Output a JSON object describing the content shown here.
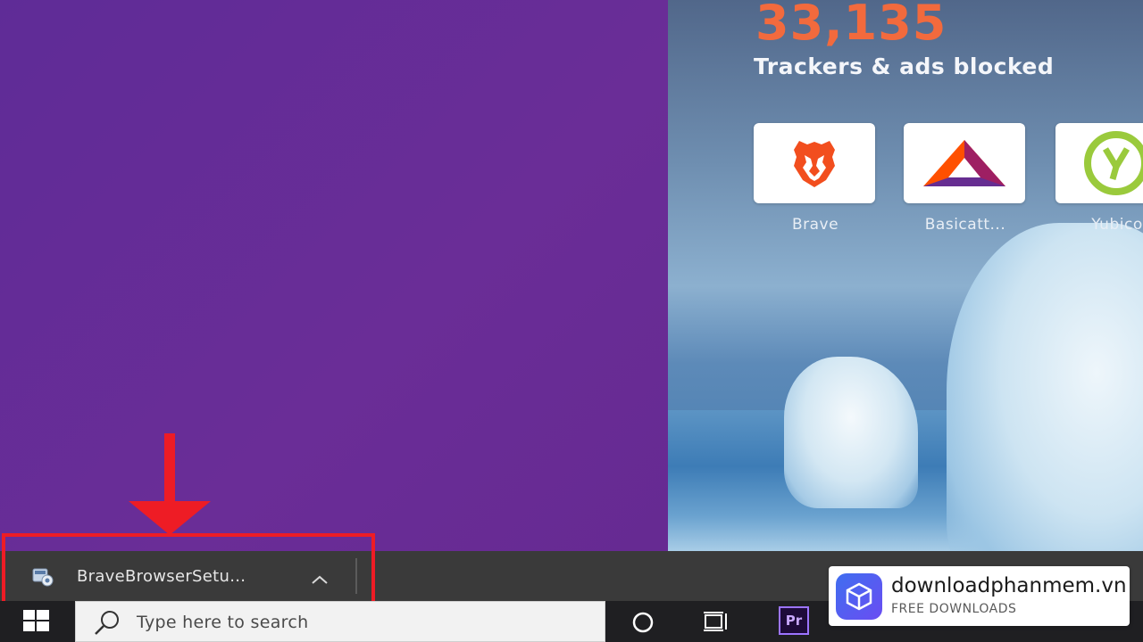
{
  "new_tab": {
    "counter_value": "33,135",
    "counter_label": "Trackers & ads blocked",
    "tiles": [
      {
        "label": "Brave",
        "icon": "brave-lion-icon"
      },
      {
        "label": "Basicatt...",
        "icon": "bat-triangle-icon"
      },
      {
        "label": "Yubico",
        "icon": "yubico-icon"
      }
    ]
  },
  "download_bar": {
    "filename": "BraveBrowserSetu...",
    "file_icon": "installer-file-icon",
    "chevron_icon": "chevron-up-icon"
  },
  "taskbar": {
    "search_placeholder": "Type here to search",
    "start_icon": "windows-start-icon",
    "search_icon": "search-icon",
    "cortana_icon": "cortana-circle-icon",
    "taskview_icon": "task-view-icon",
    "premiere_label": "Pr"
  },
  "watermark": {
    "title": "downloadphanmem.vn",
    "subtitle": "FREE DOWNLOADS"
  },
  "colors": {
    "background_purple": "#662d91",
    "counter_orange": "#f26a3d",
    "highlight_red": "#ee1c25",
    "download_bar": "#3a3a3a",
    "taskbar": "#1f1f22"
  }
}
